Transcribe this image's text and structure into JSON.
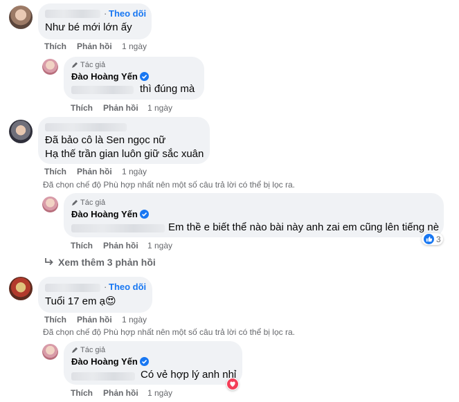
{
  "comments": [
    {
      "follow": "Theo dõi",
      "text": "Như bé mới lớn ấy",
      "like": "Thích",
      "reply": "Phản hồi",
      "time": "1 ngày"
    },
    {
      "text_lines": [
        "Đã bảo cô là Sen ngọc nữ",
        "Hạ thế trần gian luôn giữ sắc xuân"
      ],
      "like": "Thích",
      "reply": "Phản hồi",
      "time": "1 ngày"
    },
    {
      "follow": "Theo dõi",
      "text": "Tuổi 17 em ạ",
      "emoji": "😍",
      "like": "Thích",
      "reply": "Phản hồi",
      "time": "1 ngày"
    }
  ],
  "replies": [
    {
      "badge": "Tác giả",
      "name": "Đào Hoàng Yến",
      "text": "thì đúng mà",
      "like": "Thích",
      "reply": "Phản hồi",
      "time": "1 ngày"
    },
    {
      "badge": "Tác giả",
      "name": "Đào Hoàng Yến",
      "text": "Em thề e biết thể nào bài này anh zai em cũng lên tiếng nè",
      "like": "Thích",
      "reply": "Phản hồi",
      "time": "1 ngày",
      "reaction_count": "3"
    },
    {
      "badge": "Tác giả",
      "name": "Đào Hoàng Yến",
      "text": "Có vẻ hợp lý anh nhỉ",
      "like": "Thích",
      "reply": "Phản hồi",
      "time": "1 ngày"
    }
  ],
  "notice": "Đã chọn chế độ Phù hợp nhất nên một số câu trả lời có thể bị lọc ra.",
  "view_more": "Xem thêm 3 phản hồi",
  "colors": {
    "link": "#1877f2",
    "bubble": "#f0f2f5",
    "meta": "#65676b",
    "love": "#f33e58"
  },
  "icons": [
    "pencil-icon",
    "verified-badge-icon",
    "like-reaction-icon",
    "love-reaction-icon",
    "reply-arrow-icon"
  ]
}
